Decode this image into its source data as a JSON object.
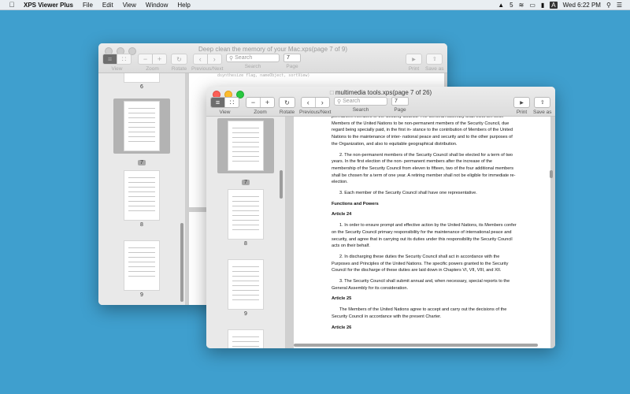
{
  "menubar": {
    "app_name": "XPS Viewer Plus",
    "menus": [
      "File",
      "Edit",
      "View",
      "Window",
      "Help"
    ],
    "status_badge": "5",
    "clock": "Wed 6:22 PM"
  },
  "back_window": {
    "title": "Deep clean the memory of your Mac.xps(page 7 of 9)",
    "toolbar": {
      "view": "View",
      "zoom": "Zoom",
      "rotate": "Rotate",
      "prevnext": "Previous/Next",
      "search": "Search",
      "search_placeholder": "Search",
      "page": "Page",
      "page_value": "7",
      "print": "Print",
      "save_as": "Save as"
    },
    "thumbs": [
      {
        "num": "6"
      },
      {
        "num": "7"
      },
      {
        "num": "8"
      },
      {
        "num": "9"
      }
    ],
    "doc_snippet": "dsynthesize flag, nameObject, sortView)"
  },
  "front_window": {
    "title": "multimedia tools.xps(page 7 of 26)",
    "toolbar": {
      "view": "View",
      "zoom": "Zoom",
      "rotate": "Rotate",
      "prevnext": "Previous/Next",
      "search": "Search",
      "search_placeholder": "Search",
      "page": "Page",
      "page_value": "7",
      "print": "Print",
      "save_as": "Save as"
    },
    "thumbs": [
      {
        "num": "7"
      },
      {
        "num": "8"
      },
      {
        "num": "9"
      }
    ],
    "doc": {
      "p1": "permanent members of the Security Council. The General Assembly shall elect ten other Members of the United Nations to be non-permanent members of the Security Council, due regard being specially paid, in the first in- stance to the contribution of Members of the United Nations to the maintenance of inter- national peace and security and to the other purposes of the Organization, and also to equitable geographical distribution.",
      "p2": "2. The non-permanent members of the Security Council shall be elected for a term of two years. In the first election of the non- permanent members after the increase of the membership of the Security Council from eleven to fifteen, two of the four additional members shall be chosen for a term of one year. A retiring member shall not be eligible for immediate re-election.",
      "p3": "3. Each member of the Security Council shall have one representative.",
      "h1": "Functions and Powers",
      "h2": "Article 24",
      "p4": "1. In order to ensure prompt and effective action by the United Nations, its Members confer on the Security Council primary responsibility for the maintenance of international peace and security, and agree that in carrying out its duties under this responsibility the Security Council acts on their behalf.",
      "p5": "2. In discharging these duties the Security Council shall act in accordance with the Purposes and Principles of the United Nations. The specific powers granted to the Security Council for the discharge of these duties are laid down in Chapters VI, VII, VIII, and XII.",
      "p6": "3. The Security Council shall submit annual and, when necessary, special reports to the General Assembly for its consideration.",
      "h3": "Article 25",
      "p7": "The Members of the United Nations agree to accept and carry out the decisions of the Security Council in accordance with the present Charter.",
      "h4": "Article 26"
    }
  }
}
